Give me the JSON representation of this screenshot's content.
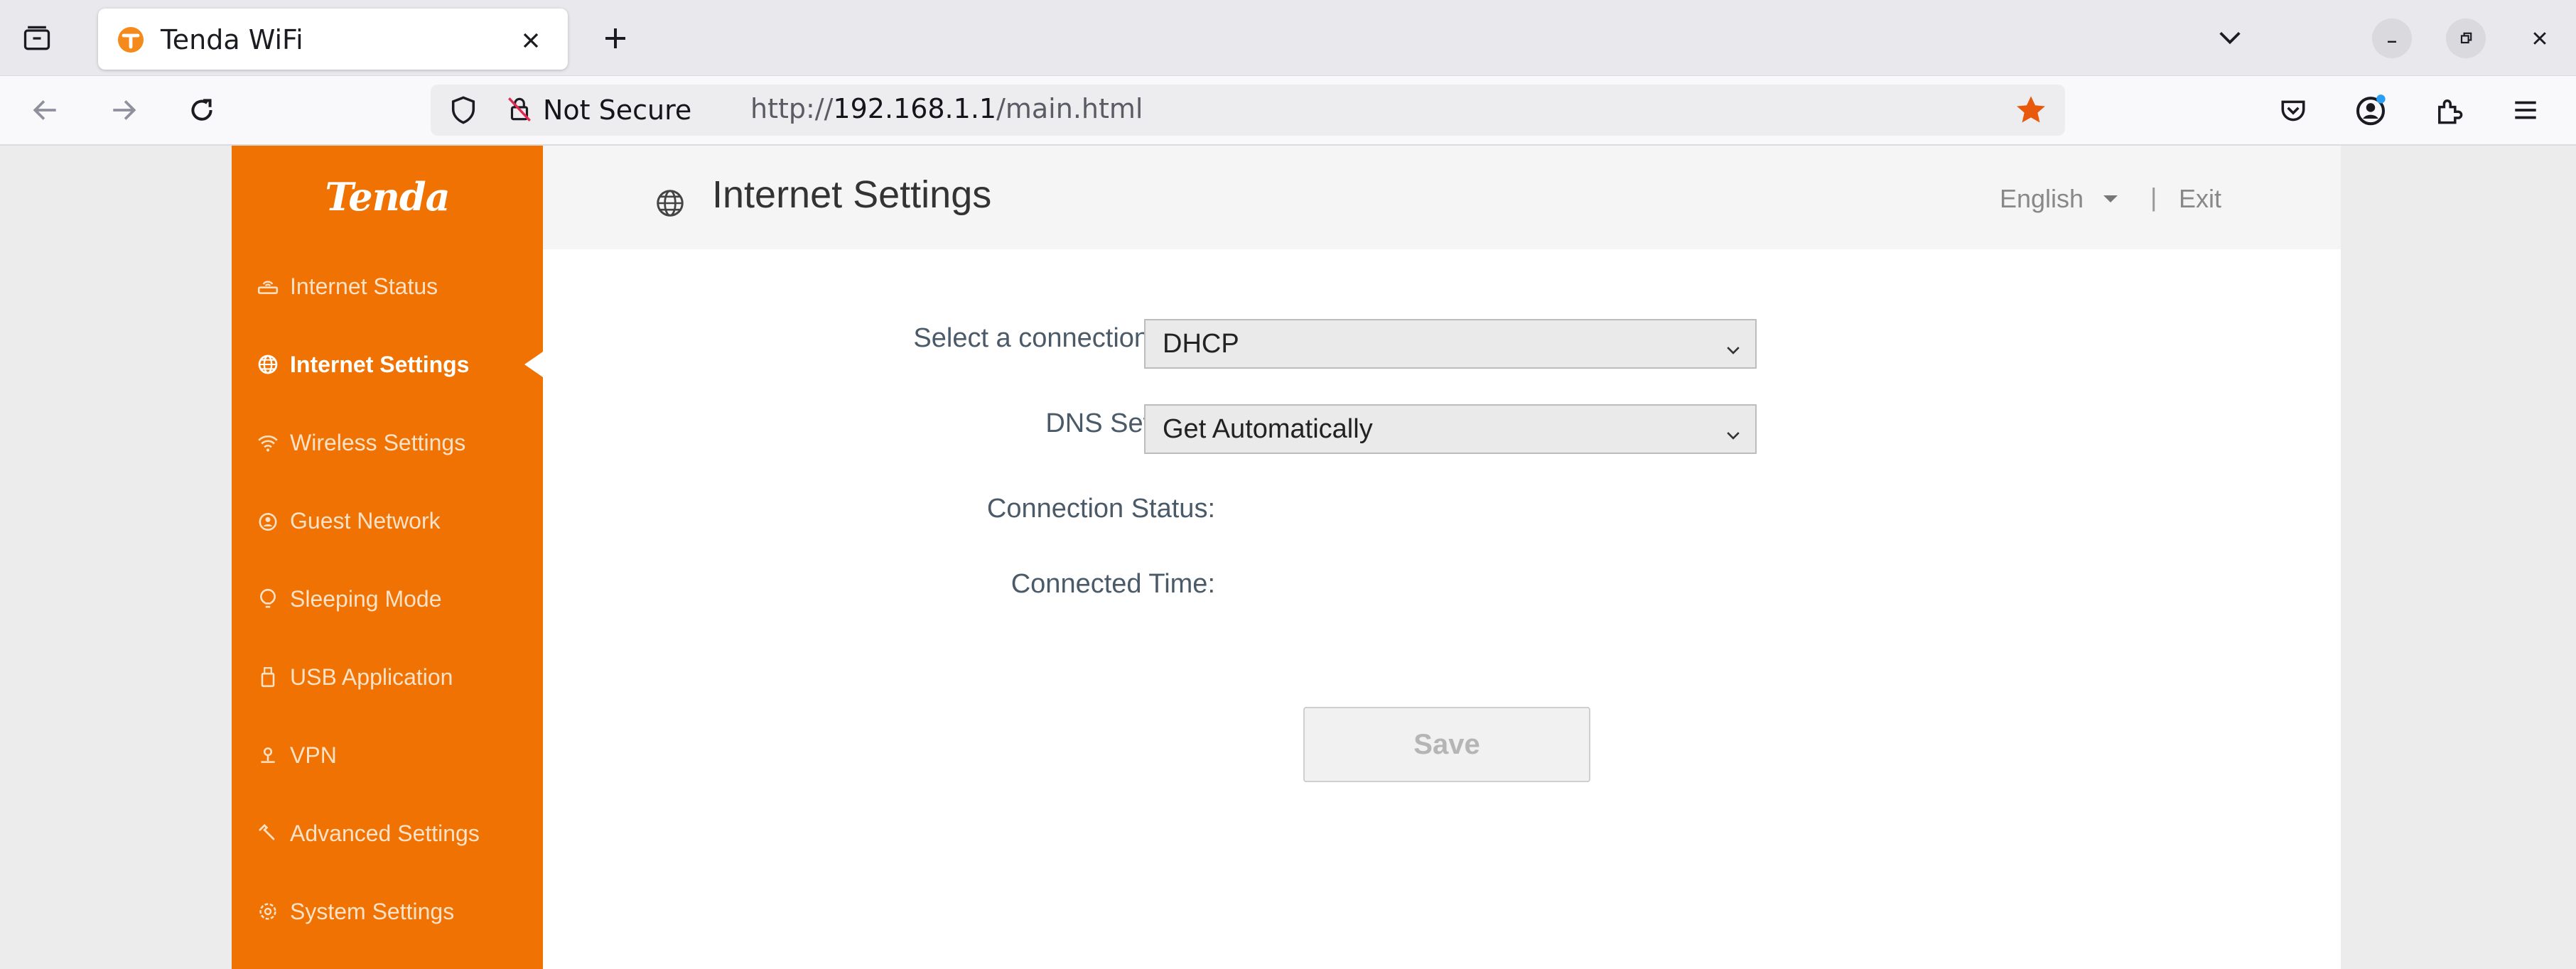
{
  "browser": {
    "tab": {
      "title": "Tenda WiFi"
    },
    "url": {
      "scheme": "http://",
      "host": "192.168.1.1",
      "path": "/main.html"
    },
    "security_label": "Not Secure",
    "colors": {
      "tabbar": "#e9e8ec",
      "toolbar": "#f9f9fb",
      "star": "#e8590c"
    }
  },
  "sidebar": {
    "logo": "Tenda",
    "color": "#f07202",
    "items": [
      {
        "label": "Internet Status",
        "icon": "router-icon",
        "active": false
      },
      {
        "label": "Internet Settings",
        "icon": "globe-icon",
        "active": true
      },
      {
        "label": "Wireless Settings",
        "icon": "wifi-icon",
        "active": false
      },
      {
        "label": "Guest Network",
        "icon": "guest-network-icon",
        "active": false
      },
      {
        "label": "Sleeping Mode",
        "icon": "sleep-icon",
        "active": false
      },
      {
        "label": "USB Application",
        "icon": "usb-icon",
        "active": false
      },
      {
        "label": "VPN",
        "icon": "vpn-icon",
        "active": false
      },
      {
        "label": "Advanced Settings",
        "icon": "wrench-icon",
        "active": false
      },
      {
        "label": "System Settings",
        "icon": "gear-icon",
        "active": false
      }
    ]
  },
  "header": {
    "title": "Internet Settings",
    "language": "English",
    "separator": "|",
    "exit": "Exit"
  },
  "form": {
    "connection_type": {
      "label": "Select a connection type:",
      "value": "DHCP"
    },
    "dns": {
      "label": "DNS Settings:",
      "value": "Get Automatically"
    },
    "connection_status": {
      "label": "Connection Status:",
      "value": ""
    },
    "connected_time": {
      "label": "Connected Time:",
      "value": ""
    },
    "save_label": "Save"
  }
}
